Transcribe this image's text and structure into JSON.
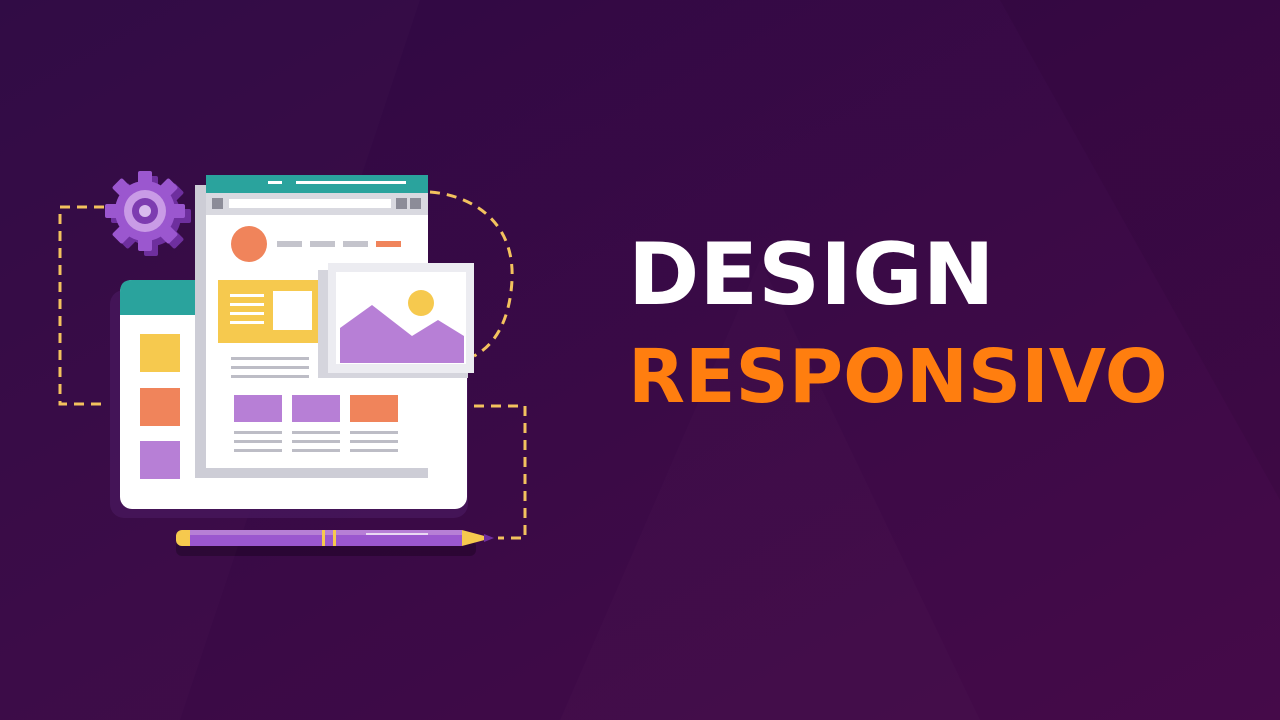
{
  "headline": {
    "line1": "DESIGN",
    "line2": "RESPONSIVO"
  },
  "colors": {
    "background": "#3a0a47",
    "line1_text": "#ffffff",
    "line2_text": "#ff7e0f",
    "teal_header": "#2aa39d",
    "orange": "#f0845b",
    "yellow": "#f6c94e",
    "lilac": "#b77fd6",
    "purple_gear": "#9b57cf",
    "dashed_line": "#f3c25e"
  },
  "icons": {
    "gear": "gear-icon",
    "image_placeholder": "image-icon",
    "pencil": "pencil-icon"
  }
}
